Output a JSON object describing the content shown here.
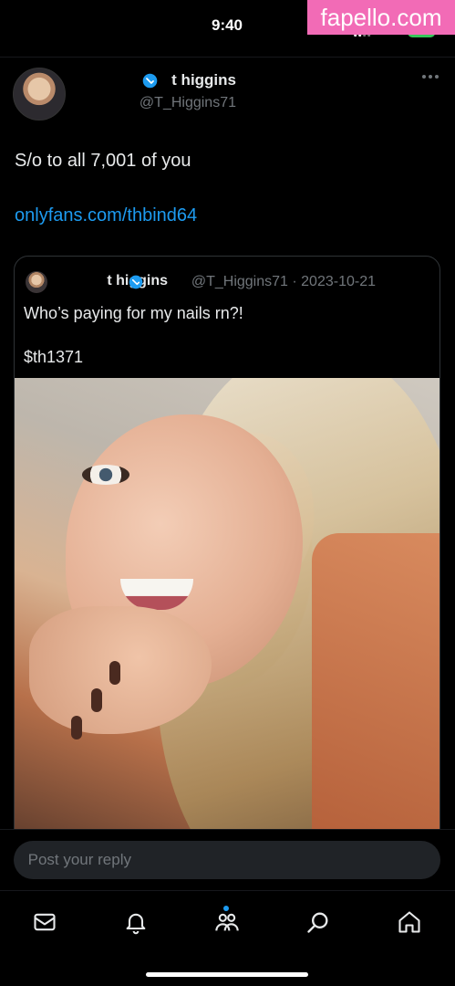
{
  "status_bar": {
    "time": "9:40",
    "network": "5G+",
    "battery": "100"
  },
  "watermark": "fapello.com",
  "tweet": {
    "author_name": "t higgins",
    "author_handle": "@T_Higgins71",
    "text": "S/o to all 7,001 of you",
    "link": "onlyfans.com/thbind64"
  },
  "quote": {
    "author_name": "t higgins",
    "meta": "@T_Higgins71 · 2023-10-21",
    "text": "Who’s paying for my nails rn?!",
    "cashtag": "$th1371"
  },
  "reply": {
    "placeholder": "Post your reply"
  },
  "nav": {
    "items": [
      "home-icon",
      "search-icon",
      "communities-icon",
      "notifications-icon",
      "messages-icon"
    ],
    "accent": "#1d9bf0"
  },
  "colors": {
    "background": "#000000",
    "text": "#e7e9ea",
    "muted": "#71767b",
    "link": "#1d9bf0",
    "verified": "#1d9bf0"
  }
}
